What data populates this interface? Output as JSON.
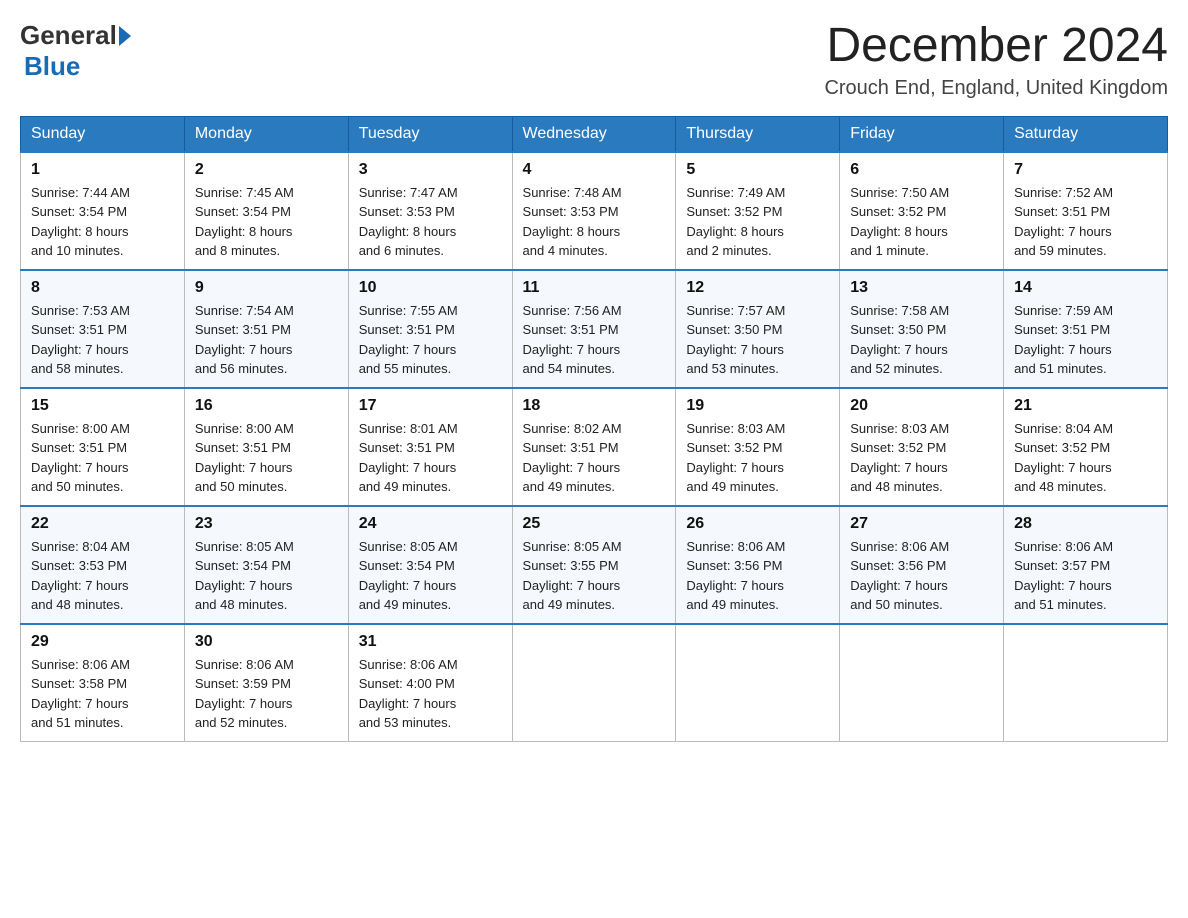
{
  "header": {
    "logo_general": "General",
    "logo_blue": "Blue",
    "title": "December 2024",
    "subtitle": "Crouch End, England, United Kingdom"
  },
  "days_of_week": [
    "Sunday",
    "Monday",
    "Tuesday",
    "Wednesday",
    "Thursday",
    "Friday",
    "Saturday"
  ],
  "weeks": [
    [
      {
        "day": "1",
        "sunrise": "Sunrise: 7:44 AM",
        "sunset": "Sunset: 3:54 PM",
        "daylight": "Daylight: 8 hours",
        "daylight2": "and 10 minutes."
      },
      {
        "day": "2",
        "sunrise": "Sunrise: 7:45 AM",
        "sunset": "Sunset: 3:54 PM",
        "daylight": "Daylight: 8 hours",
        "daylight2": "and 8 minutes."
      },
      {
        "day": "3",
        "sunrise": "Sunrise: 7:47 AM",
        "sunset": "Sunset: 3:53 PM",
        "daylight": "Daylight: 8 hours",
        "daylight2": "and 6 minutes."
      },
      {
        "day": "4",
        "sunrise": "Sunrise: 7:48 AM",
        "sunset": "Sunset: 3:53 PM",
        "daylight": "Daylight: 8 hours",
        "daylight2": "and 4 minutes."
      },
      {
        "day": "5",
        "sunrise": "Sunrise: 7:49 AM",
        "sunset": "Sunset: 3:52 PM",
        "daylight": "Daylight: 8 hours",
        "daylight2": "and 2 minutes."
      },
      {
        "day": "6",
        "sunrise": "Sunrise: 7:50 AM",
        "sunset": "Sunset: 3:52 PM",
        "daylight": "Daylight: 8 hours",
        "daylight2": "and 1 minute."
      },
      {
        "day": "7",
        "sunrise": "Sunrise: 7:52 AM",
        "sunset": "Sunset: 3:51 PM",
        "daylight": "Daylight: 7 hours",
        "daylight2": "and 59 minutes."
      }
    ],
    [
      {
        "day": "8",
        "sunrise": "Sunrise: 7:53 AM",
        "sunset": "Sunset: 3:51 PM",
        "daylight": "Daylight: 7 hours",
        "daylight2": "and 58 minutes."
      },
      {
        "day": "9",
        "sunrise": "Sunrise: 7:54 AM",
        "sunset": "Sunset: 3:51 PM",
        "daylight": "Daylight: 7 hours",
        "daylight2": "and 56 minutes."
      },
      {
        "day": "10",
        "sunrise": "Sunrise: 7:55 AM",
        "sunset": "Sunset: 3:51 PM",
        "daylight": "Daylight: 7 hours",
        "daylight2": "and 55 minutes."
      },
      {
        "day": "11",
        "sunrise": "Sunrise: 7:56 AM",
        "sunset": "Sunset: 3:51 PM",
        "daylight": "Daylight: 7 hours",
        "daylight2": "and 54 minutes."
      },
      {
        "day": "12",
        "sunrise": "Sunrise: 7:57 AM",
        "sunset": "Sunset: 3:50 PM",
        "daylight": "Daylight: 7 hours",
        "daylight2": "and 53 minutes."
      },
      {
        "day": "13",
        "sunrise": "Sunrise: 7:58 AM",
        "sunset": "Sunset: 3:50 PM",
        "daylight": "Daylight: 7 hours",
        "daylight2": "and 52 minutes."
      },
      {
        "day": "14",
        "sunrise": "Sunrise: 7:59 AM",
        "sunset": "Sunset: 3:51 PM",
        "daylight": "Daylight: 7 hours",
        "daylight2": "and 51 minutes."
      }
    ],
    [
      {
        "day": "15",
        "sunrise": "Sunrise: 8:00 AM",
        "sunset": "Sunset: 3:51 PM",
        "daylight": "Daylight: 7 hours",
        "daylight2": "and 50 minutes."
      },
      {
        "day": "16",
        "sunrise": "Sunrise: 8:00 AM",
        "sunset": "Sunset: 3:51 PM",
        "daylight": "Daylight: 7 hours",
        "daylight2": "and 50 minutes."
      },
      {
        "day": "17",
        "sunrise": "Sunrise: 8:01 AM",
        "sunset": "Sunset: 3:51 PM",
        "daylight": "Daylight: 7 hours",
        "daylight2": "and 49 minutes."
      },
      {
        "day": "18",
        "sunrise": "Sunrise: 8:02 AM",
        "sunset": "Sunset: 3:51 PM",
        "daylight": "Daylight: 7 hours",
        "daylight2": "and 49 minutes."
      },
      {
        "day": "19",
        "sunrise": "Sunrise: 8:03 AM",
        "sunset": "Sunset: 3:52 PM",
        "daylight": "Daylight: 7 hours",
        "daylight2": "and 49 minutes."
      },
      {
        "day": "20",
        "sunrise": "Sunrise: 8:03 AM",
        "sunset": "Sunset: 3:52 PM",
        "daylight": "Daylight: 7 hours",
        "daylight2": "and 48 minutes."
      },
      {
        "day": "21",
        "sunrise": "Sunrise: 8:04 AM",
        "sunset": "Sunset: 3:52 PM",
        "daylight": "Daylight: 7 hours",
        "daylight2": "and 48 minutes."
      }
    ],
    [
      {
        "day": "22",
        "sunrise": "Sunrise: 8:04 AM",
        "sunset": "Sunset: 3:53 PM",
        "daylight": "Daylight: 7 hours",
        "daylight2": "and 48 minutes."
      },
      {
        "day": "23",
        "sunrise": "Sunrise: 8:05 AM",
        "sunset": "Sunset: 3:54 PM",
        "daylight": "Daylight: 7 hours",
        "daylight2": "and 48 minutes."
      },
      {
        "day": "24",
        "sunrise": "Sunrise: 8:05 AM",
        "sunset": "Sunset: 3:54 PM",
        "daylight": "Daylight: 7 hours",
        "daylight2": "and 49 minutes."
      },
      {
        "day": "25",
        "sunrise": "Sunrise: 8:05 AM",
        "sunset": "Sunset: 3:55 PM",
        "daylight": "Daylight: 7 hours",
        "daylight2": "and 49 minutes."
      },
      {
        "day": "26",
        "sunrise": "Sunrise: 8:06 AM",
        "sunset": "Sunset: 3:56 PM",
        "daylight": "Daylight: 7 hours",
        "daylight2": "and 49 minutes."
      },
      {
        "day": "27",
        "sunrise": "Sunrise: 8:06 AM",
        "sunset": "Sunset: 3:56 PM",
        "daylight": "Daylight: 7 hours",
        "daylight2": "and 50 minutes."
      },
      {
        "day": "28",
        "sunrise": "Sunrise: 8:06 AM",
        "sunset": "Sunset: 3:57 PM",
        "daylight": "Daylight: 7 hours",
        "daylight2": "and 51 minutes."
      }
    ],
    [
      {
        "day": "29",
        "sunrise": "Sunrise: 8:06 AM",
        "sunset": "Sunset: 3:58 PM",
        "daylight": "Daylight: 7 hours",
        "daylight2": "and 51 minutes."
      },
      {
        "day": "30",
        "sunrise": "Sunrise: 8:06 AM",
        "sunset": "Sunset: 3:59 PM",
        "daylight": "Daylight: 7 hours",
        "daylight2": "and 52 minutes."
      },
      {
        "day": "31",
        "sunrise": "Sunrise: 8:06 AM",
        "sunset": "Sunset: 4:00 PM",
        "daylight": "Daylight: 7 hours",
        "daylight2": "and 53 minutes."
      },
      null,
      null,
      null,
      null
    ]
  ]
}
